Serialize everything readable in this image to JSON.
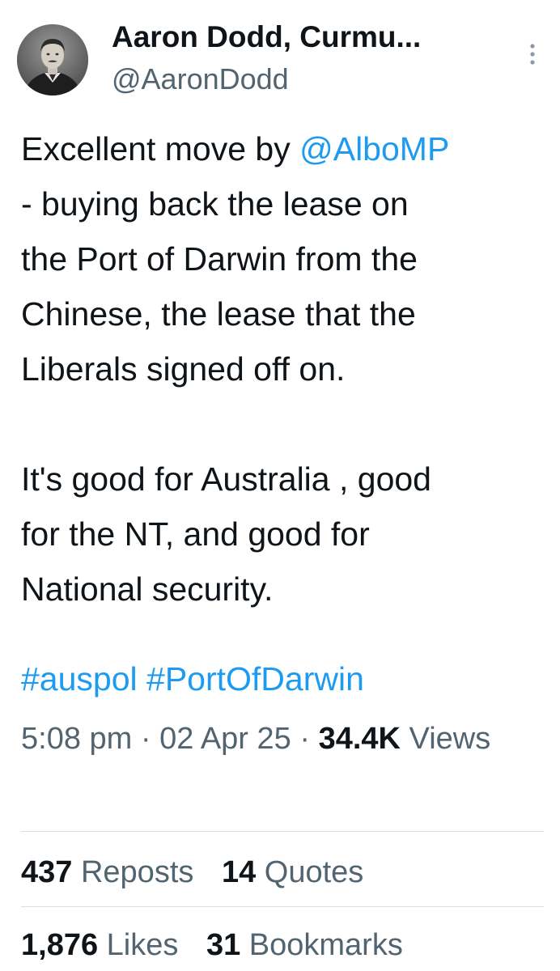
{
  "author": {
    "display_name": "Aaron Dodd, Curmu...",
    "handle": "@AaronDodd",
    "avatar_icon": "vintage-portrait-avatar"
  },
  "more_icon": "vertical-ellipsis-icon",
  "tweet": {
    "line1_prefix": "Excellent move by ",
    "mention": "@AlboMP",
    "line2": "- buying back the lease on",
    "line3": "the Port of Darwin from the",
    "line4": "Chinese, the lease that the",
    "line5": "Liberals signed off on.",
    "line6": "It's good for Australia , good",
    "line7": "for the NT, and good for",
    "line8": "National security.",
    "hashtags": [
      "#auspol",
      "#PortOfDarwin"
    ]
  },
  "meta": {
    "time": "5:08 pm",
    "separator": " · ",
    "date": "02 Apr 25",
    "views_count": "34.4K",
    "views_label": "Views"
  },
  "stats": {
    "reposts_count": "437",
    "reposts_label": "Reposts",
    "quotes_count": "14",
    "quotes_label": "Quotes",
    "likes_count": "1,876",
    "likes_label": "Likes",
    "bookmarks_count": "31",
    "bookmarks_label": "Bookmarks"
  },
  "colors": {
    "link": "#1d9bf0",
    "text": "#0f1419",
    "secondary": "#536471",
    "divider": "#d9dee2"
  }
}
